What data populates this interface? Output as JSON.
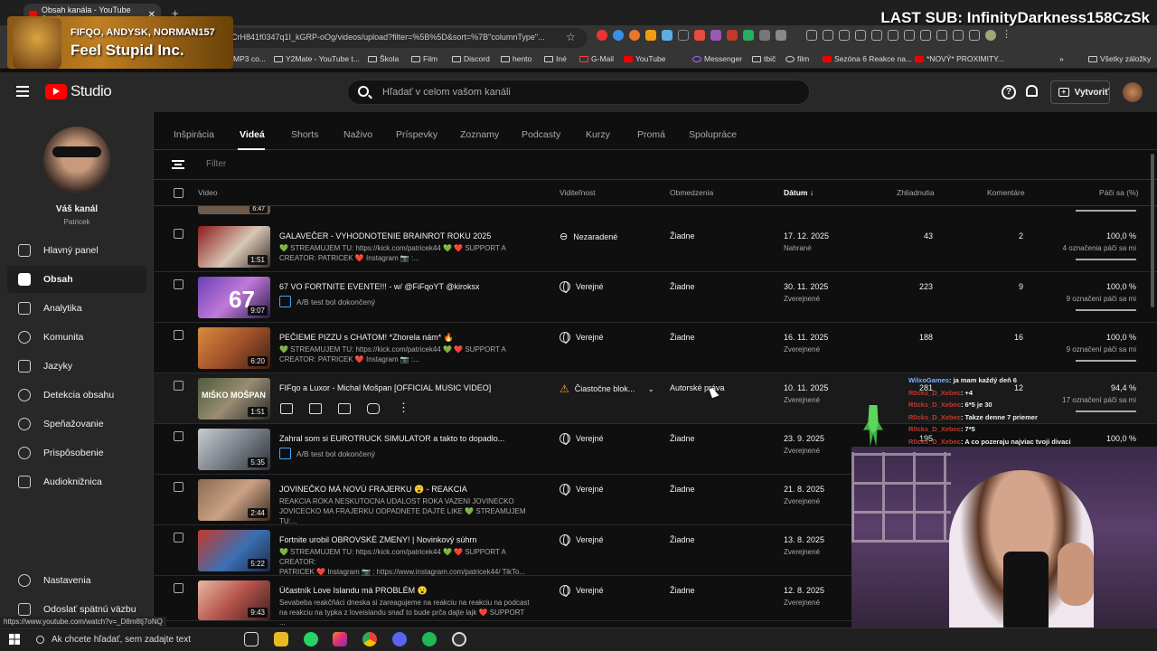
{
  "browser": {
    "tab_title": "Obsah kanála - YouTube Studio",
    "url": "CrH841f0347q1I_kGRP-oOg/videos/upload?filter=%5B%5D&sort=%7B\"columnType\"...",
    "bookmarks": [
      "MP3 co...",
      "Y2Mate - YouTube t...",
      "Škola",
      "Film",
      "Discord",
      "hento",
      "Iné",
      "G-Mail",
      "YouTube",
      "Messenger",
      "tbič",
      "film",
      "Sezóna 6 Reakce na...",
      "*NOVÝ* PROXIMITY...",
      "Všetky záložky"
    ]
  },
  "overlay": {
    "names": "FIFQO, ANDYSK, NORMAN157",
    "title": "Feel Stupid Inc.",
    "last_sub": "LAST SUB: InfinityDarkness158CzSk"
  },
  "header": {
    "studio_label": "Studio",
    "search_placeholder": "Hľadať v celom vašom kanáli",
    "create_label": "Vytvoriť"
  },
  "sidebar": {
    "channel_title": "Váš kanál",
    "channel_handle": "Patricek",
    "items": [
      {
        "label": "Hlavný panel"
      },
      {
        "label": "Obsah"
      },
      {
        "label": "Analytika"
      },
      {
        "label": "Komunita"
      },
      {
        "label": "Jazyky"
      },
      {
        "label": "Detekcia obsahu"
      },
      {
        "label": "Speňažovanie"
      },
      {
        "label": "Prispôsobenie"
      },
      {
        "label": "Audioknižnica"
      }
    ],
    "settings": "Nastavenia",
    "feedback": "Odoslať spätnú väzbu"
  },
  "tabs": [
    "Inšpirácia",
    "Videá",
    "Shorts",
    "Naživo",
    "Príspevky",
    "Zoznamy",
    "Podcasty",
    "Kurzy",
    "Promá",
    "Spolupráce"
  ],
  "filter_label": "Filter",
  "table": {
    "headers": {
      "video": "Video",
      "visibility": "Viditeľnost",
      "restrictions": "Obmedzenia",
      "date": "Dátum",
      "views": "Zhliadnutia",
      "comments": "Komentáre",
      "likes": "Páči sa (%)"
    },
    "partial_duration": "6:47",
    "rows": [
      {
        "title": "GALAVEČER - VYHODNOTENIE BRAINROT ROKU 2025",
        "desc1": "💚 STREAMUJEM TU: https://kick.com/patricek44 💚 ❤️ SUPPORT A",
        "desc2": "CREATOR: PATRICEK ❤️ Instagram 📷 :...",
        "duration": "1:51",
        "visibility": "Nezaradené",
        "restrictions": "Žiadne",
        "date": "17. 12. 2025",
        "date_sub": "Nahrané",
        "views": "43",
        "comments": "2",
        "likes": "100,0 %",
        "likes_sub": "4 označenia páči sa mi"
      },
      {
        "title": "67 VO FORTNITE EVENTE!!! - w/ @FiFqoYT @kiroksx",
        "ab": "A/B test bol dokončený",
        "duration": "9:07",
        "visibility": "Verejné",
        "restrictions": "Žiadne",
        "date": "30. 11. 2025",
        "date_sub": "Zverejnené",
        "views": "223",
        "comments": "9",
        "likes": "100,0 %",
        "likes_sub": "9 označení páči sa mi"
      },
      {
        "title": "PEČIEME PIZZU s CHATOM! *Zhorela nám* 🔥",
        "desc1": "💚 STREAMUJEM TU: https://kick.com/patricek44 💚 ❤️ SUPPORT A",
        "desc2": "CREATOR: PATRICEK ❤️ Instagram 📷 :...",
        "duration": "6:20",
        "visibility": "Verejné",
        "restrictions": "Žiadne",
        "date": "16. 11. 2025",
        "date_sub": "Zverejnené",
        "views": "188",
        "comments": "16",
        "likes": "100,0 %",
        "likes_sub": "9 označení páči sa mi"
      },
      {
        "title": "FIFqo a Luxor - Michal Mošpan [OFFICIAL MUSIC VIDEO]",
        "duration": "1:51",
        "visibility": "Čiastočne blok...",
        "restrictions": "Autorské práva",
        "date": "10. 11. 2025",
        "date_sub": "Zverejnené",
        "views": "281",
        "comments": "12",
        "likes": "94,4 %",
        "likes_sub": "17 označení páči sa mi"
      },
      {
        "title": "Zahral som si EUROTRUCK SIMULATOR a takto to dopadlo...",
        "ab": "A/B test bol dokončený",
        "duration": "5:35",
        "visibility": "Verejné",
        "restrictions": "Žiadne",
        "date": "23. 9. 2025",
        "date_sub": "Zverejnené",
        "views": "195",
        "comments": "",
        "likes": "100,0 %",
        "likes_sub": ""
      },
      {
        "title": "JOVINEČKO MÁ NOVÚ FRAJERKU 😮 - REAKCIA",
        "desc1": "REAKCIA ROKA NESKUTOCNA UDALOST ROKA VAZENI JOVINECKO",
        "desc2": "JOVICECKO MA FRAJERKU ODPADNETE DAJTE LIKE 💚 STREAMUJEM TU:...",
        "duration": "2:44",
        "visibility": "Verejné",
        "restrictions": "Žiadne",
        "date": "21. 8. 2025",
        "date_sub": "Zverejnené",
        "views": "",
        "comments": "",
        "likes": "",
        "likes_sub": ""
      },
      {
        "title": "Fortnite urobil OBROVSKÉ ZMENY! | Novinkový súhrn",
        "desc1": "💚 STREAMUJEM TU: https://kick.com/patricek44 💚 ❤️ SUPPORT A CREATOR:",
        "desc2": "PATRICEK ❤️ Instagram 📷 : https://www.instagram.com/patricek44/ TikTo...",
        "duration": "5:22",
        "visibility": "Verejné",
        "restrictions": "Žiadne",
        "date": "13. 8. 2025",
        "date_sub": "Zverejnené",
        "views": "",
        "comments": "",
        "likes": "",
        "likes_sub": ""
      },
      {
        "title": "Účastník Love Islandu má PROBLÉM 😮",
        "desc1": "Sevabeba reakčňáci dneska si zareagujeme na reakciu na reakciu na podcast",
        "desc2": "na reakciu na typka z loveislandu snaď to bude prča dajte lajk ❤️ SUPPORT ...",
        "duration": "9:43",
        "visibility": "Verejné",
        "restrictions": "Žiadne",
        "date": "12. 8. 2025",
        "date_sub": "Zverejnené",
        "views": "",
        "comments": "",
        "likes": "",
        "likes_sub": ""
      }
    ]
  },
  "chat": [
    {
      "user": "WilxoGames",
      "msg": ": ja mam každý deň 6"
    },
    {
      "user": "R0cks_D_Xebec",
      "msg": ": +4"
    },
    {
      "user": "R0cks_D_Xebec",
      "msg": ": 6*5 je 30"
    },
    {
      "user": "R0cks_D_Xebec",
      "msg": ": Takze denne 7 priemer"
    },
    {
      "user": "R0cks_D_Xebec",
      "msg": ": 7*5"
    },
    {
      "user": "R0cks_D_Xebec",
      "msg": ": A co pozeraju najviac tvoji divaci"
    }
  ],
  "status_url": "https://www.youtube.com/watch?v=_D8m8tj7oNQ",
  "taskbar": {
    "search_placeholder": "Ak chcete hľadať, sem zadajte text"
  }
}
